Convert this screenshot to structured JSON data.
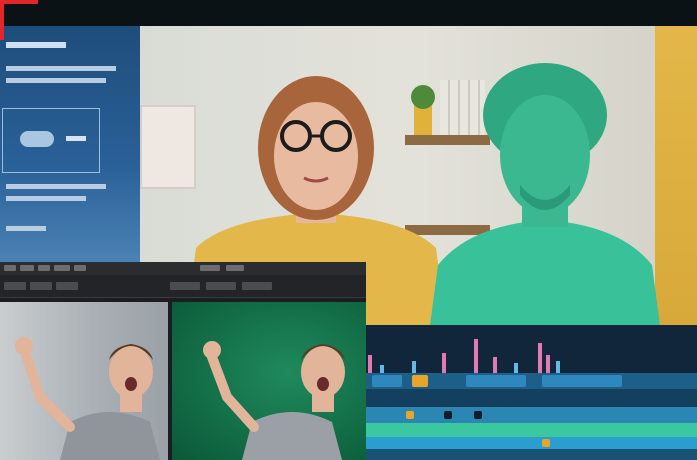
{
  "image": {
    "description_items": [
      "hero",
      "editor",
      "timeline"
    ]
  },
  "colors": {
    "accent_red": "#e3262a",
    "greenscreen": "#126c46",
    "keyed_overlay": "#39c29a",
    "shirt_yellow": "#e3b749",
    "timeline_bg": "#0f1d2b"
  }
}
